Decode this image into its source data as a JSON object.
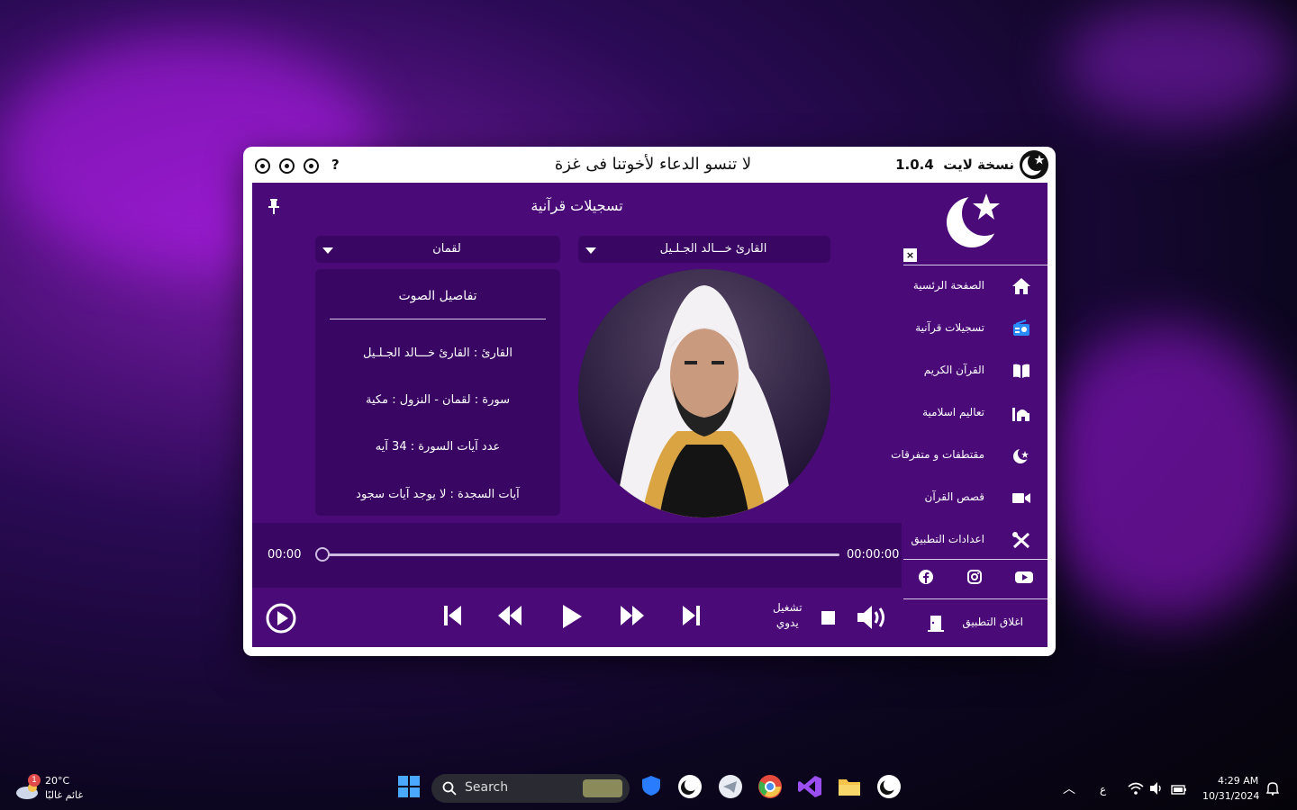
{
  "app": {
    "version_label": "1.0.4",
    "edition_label": "نسخة لايت",
    "banner": "لا تنسو الدعاء لأخوتنا فى غزة",
    "help_label": "?"
  },
  "main": {
    "title": "تسجيلات قرآنية",
    "reciter_dropdown": "القارئ خـــالد الجـلـيل",
    "surah_dropdown": "لقمان",
    "details": {
      "header": "تفاصيل الصوت",
      "reciter_row": "القارئ : القارئ خـــالد الجـلـيل",
      "surah_row": "سورة  :  لقمان  -  النزول  :  مكية",
      "ayat_count_row": "عدد آيات السورة :  34  آيه",
      "sajda_row": "آيات السجدة  :  لا يوجد آيات سجود"
    }
  },
  "player": {
    "current_time": "00:00",
    "total_time": "00:00:00",
    "progress": 0,
    "manual_label_1": "تشغيل",
    "manual_label_2": "يدوي"
  },
  "sidebar": {
    "items": [
      {
        "label": "الصفحة الرئسية",
        "icon": "home-icon"
      },
      {
        "label": "تسجيلات قرآنية",
        "icon": "radio-icon"
      },
      {
        "label": "القرآن الكريم",
        "icon": "book-icon"
      },
      {
        "label": "تعاليم اسلامية",
        "icon": "mosque-icon"
      },
      {
        "label": "مقتطفات و متفرقات",
        "icon": "crescent-icon"
      },
      {
        "label": "قصص القرآن",
        "icon": "video-icon"
      },
      {
        "label": "اعدادات التطبيق",
        "icon": "tools-icon"
      }
    ],
    "exit_label": "اغلاق التطبيق",
    "close_label": "×"
  },
  "taskbar": {
    "weather_temp": "20°C",
    "weather_desc": "غائم غالبًا",
    "weather_badge": "1",
    "search_label": "Search",
    "lang": "ع",
    "time": "4:29 AM",
    "date": "10/31/2024"
  },
  "colors": {
    "panel": "#4a0a78",
    "panel_dark": "#3a0663",
    "accent": "#2a8cff"
  }
}
